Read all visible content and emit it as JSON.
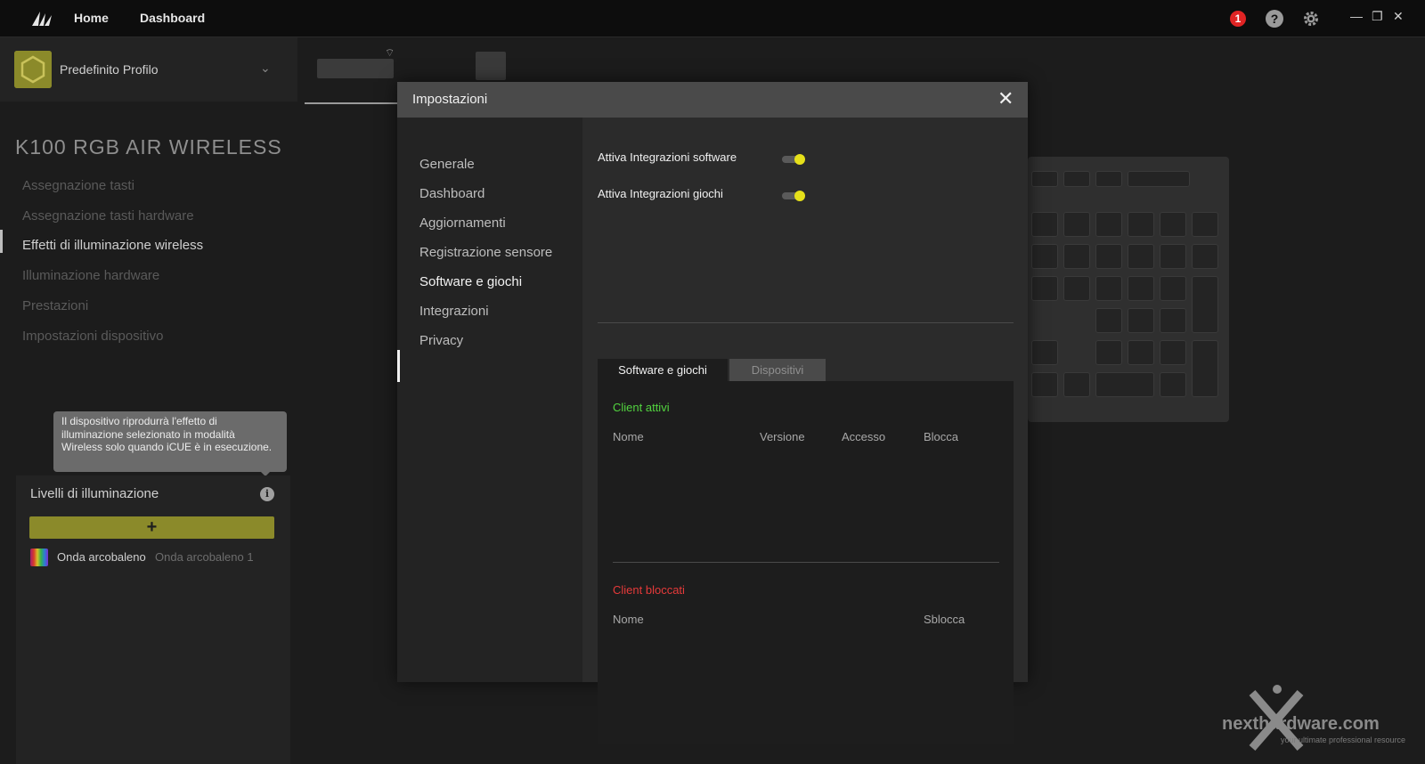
{
  "topbar": {
    "nav": [
      "Home",
      "Dashboard"
    ],
    "notification_count": "1",
    "help_glyph": "?",
    "window_controls": [
      "—",
      "❐",
      "✕"
    ],
    "icons": [
      "corsair-sails-logo",
      "help-icon",
      "gear-icon"
    ]
  },
  "profile": {
    "name": "Predefinito Profilo",
    "chevron": "⌄"
  },
  "device": {
    "title": "K100 RGB AIR WIRELESS",
    "wifi_glyph": "⌔"
  },
  "sidebar_menu": [
    "Assegnazione tasti",
    "Assegnazione tasti hardware",
    "Effetti di illuminazione wireless",
    "Illuminazione hardware",
    "Prestazioni",
    "Impostazioni dispositivo"
  ],
  "tooltip": {
    "text": "Il dispositivo riprodurrà l'effetto di illuminazione selezionato in modalità Wireless solo quando iCUE è in esecuzione."
  },
  "layers": {
    "title": "Livelli di illuminazione",
    "info_glyph": "i",
    "add_glyph": "+",
    "items": [
      {
        "name": "Onda arcobaleno",
        "sub": "Onda arcobaleno 1"
      }
    ]
  },
  "dialog": {
    "title": "Impostazioni",
    "close_glyph": "✕",
    "nav": [
      "Generale",
      "Dashboard",
      "Aggiornamenti",
      "Registrazione sensore",
      "Software e giochi",
      "Integrazioni",
      "Privacy"
    ],
    "active_nav": "Software e giochi",
    "toggles": [
      {
        "label": "Attiva Integrazioni software",
        "on": true
      },
      {
        "label": "Attiva Integrazioni giochi",
        "on": true
      }
    ],
    "tabs": [
      "Software e giochi",
      "Dispositivi"
    ],
    "active_tab": "Software e giochi",
    "active_clients": {
      "title": "Client attivi",
      "columns": [
        "Nome",
        "Versione",
        "Accesso",
        "Blocca"
      ]
    },
    "blocked_clients": {
      "title": "Client bloccati",
      "columns": [
        "Nome",
        "Sblocca"
      ]
    }
  },
  "watermark": {
    "main": "nexthardware.com",
    "sub": "your ultimate professional resource"
  },
  "colors": {
    "accent_yellow": "#e6e01a",
    "profile_olive": "#8b8a2a",
    "active_green": "#52d43f",
    "blocked_red": "#e63a3a",
    "badge_red": "#e02424"
  }
}
